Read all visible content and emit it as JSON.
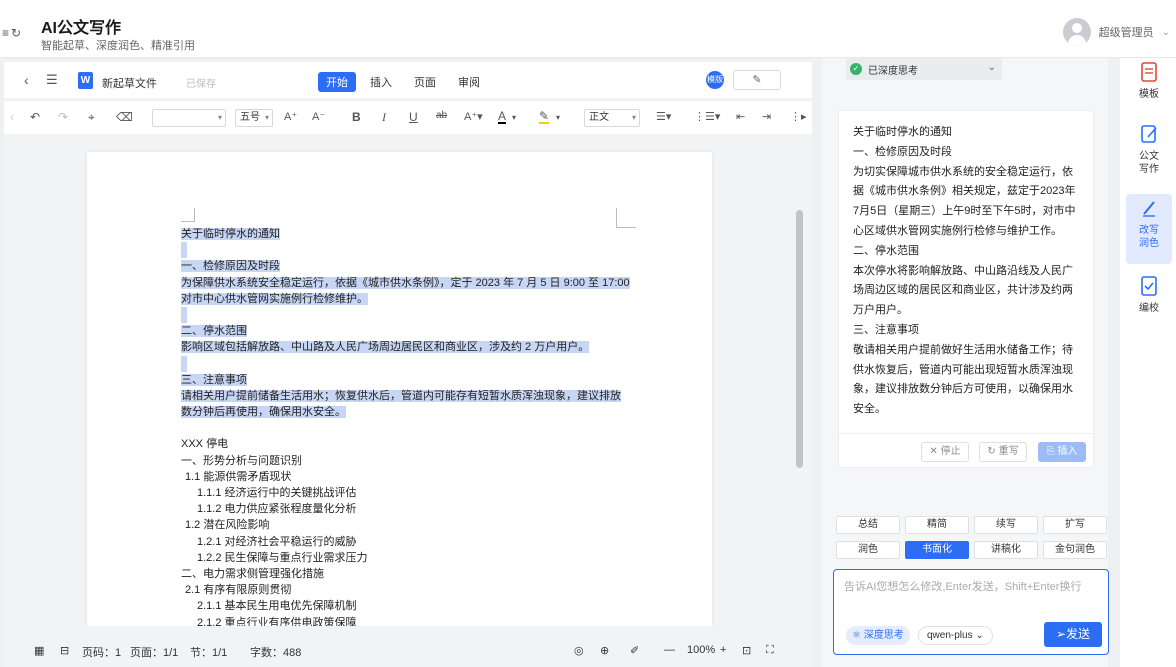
{
  "header": {
    "title": "AI公文写作",
    "subtitle": "智能起草、深度润色、精准引用",
    "user_name": "超级管理员"
  },
  "doc_bar": {
    "file_name": "新起草文件",
    "save_status": "已保存",
    "tabs": [
      {
        "label": "开始",
        "active": true
      },
      {
        "label": "插入",
        "active": false
      },
      {
        "label": "页面",
        "active": false
      },
      {
        "label": "审阅",
        "active": false
      }
    ],
    "share_label": "模版"
  },
  "toolbar": {
    "font_name": "",
    "font_size": "五号",
    "paragraph_style": "正文"
  },
  "document": {
    "lines": [
      {
        "text": "关于临时停水的通知",
        "selected": true,
        "indent": 0
      },
      {
        "text": "",
        "selected": true,
        "indent": 0
      },
      {
        "text": "一、检修原因及时段",
        "selected": true,
        "indent": 0
      },
      {
        "text": "为保障供水系统安全稳定运行，依据《城市供水条例》，定于 2023 年 7 月 5 日 9:00 至 17:00",
        "selected": true,
        "indent": 0
      },
      {
        "text": "对市中心供水管网实施例行检修维护。",
        "selected": true,
        "indent": 0
      },
      {
        "text": "",
        "selected": true,
        "indent": 0
      },
      {
        "text": "二、停水范围",
        "selected": true,
        "indent": 0
      },
      {
        "text": "影响区域包括解放路、中山路及人民广场周边居民区和商业区，涉及约 2 万户用户。",
        "selected": true,
        "indent": 0
      },
      {
        "text": "",
        "selected": true,
        "indent": 0
      },
      {
        "text": "三、注意事项",
        "selected": true,
        "indent": 0
      },
      {
        "text": "请相关用户提前储备生活用水；恢复供水后，管道内可能存有短暂水质浑浊现象，建议排放",
        "selected": true,
        "indent": 0
      },
      {
        "text": "数分钟后再使用，确保用水安全。",
        "selected": true,
        "indent": 0
      },
      {
        "text": "",
        "selected": false,
        "indent": 0
      },
      {
        "text": "XXX 停电",
        "selected": false,
        "indent": 0
      },
      {
        "text": "一、形势分析与问题识别",
        "selected": false,
        "indent": 0
      },
      {
        "text": "1.1  能源供需矛盾现状",
        "selected": false,
        "indent": 1
      },
      {
        "text": "1.1.1  经济运行中的关键挑战评估",
        "selected": false,
        "indent": 2
      },
      {
        "text": "1.1.2  电力供应紧张程度量化分析",
        "selected": false,
        "indent": 2
      },
      {
        "text": "1.2  潜在风险影响",
        "selected": false,
        "indent": 1
      },
      {
        "text": "1.2.1  对经济社会平稳运行的威胁",
        "selected": false,
        "indent": 2
      },
      {
        "text": "1.2.2  民生保障与重点行业需求压力",
        "selected": false,
        "indent": 2
      },
      {
        "text": "二、电力需求侧管理强化措施",
        "selected": false,
        "indent": 0
      },
      {
        "text": "2.1  有序有限原则贯彻",
        "selected": false,
        "indent": 1
      },
      {
        "text": "2.1.1  基本民生用电优先保障机制",
        "selected": false,
        "indent": 2
      },
      {
        "text": "2.1.2  重点行业有序供电政策保障",
        "selected": false,
        "indent": 2
      }
    ]
  },
  "status_bar": {
    "page_label": "页码：1",
    "pages_label": "页面：1/1",
    "section_label": "节：1/1",
    "word_count": "字数：488",
    "zoom": "100%"
  },
  "ai_panel": {
    "deep_thought_label": "已深度思考",
    "result_lines": [
      "关于临时停水的通知",
      "一、检修原因及时段",
      "为切实保障城市供水系统的安全稳定运行，依",
      "据《城市供水条例》相关规定，兹定于2023年",
      "7月5日（星期三）上午9时至下午5时，对市中",
      "心区域供水管网实施例行检修与维护工作。",
      "二、停水范围",
      "本次停水将影响解放路、中山路沿线及人民广",
      "场周边区域的居民区和商业区，共计涉及约两",
      "万户用户。",
      "三、注意事项",
      "敬请相关用户提前做好生活用水储备工作；待",
      "供水恢复后，管道内可能出现短暂水质浑浊现",
      "象，建议排放数分钟后方可使用，以确保用水",
      "安全。"
    ],
    "actions": {
      "stop": "停止",
      "rewrite": "重写",
      "insert": "插入"
    },
    "quick_actions": [
      {
        "label": "总结",
        "active": false
      },
      {
        "label": "精简",
        "active": false
      },
      {
        "label": "续写",
        "active": false
      },
      {
        "label": "扩写",
        "active": false
      },
      {
        "label": "润色",
        "active": false
      },
      {
        "label": "书面化",
        "active": true
      },
      {
        "label": "讲稿化",
        "active": false
      },
      {
        "label": "金句润色",
        "active": false
      }
    ],
    "input_placeholder": "告诉AI您想怎么修改,Enter发送，Shift+Enter换行",
    "deep_chip": "深度思考",
    "model": "qwen-plus",
    "send_label": "发送"
  },
  "right_sidebar": {
    "items": [
      {
        "label": "模板",
        "active": false
      },
      {
        "label": "公文\n写作",
        "active": false
      },
      {
        "label": "改写\n润色",
        "active": true
      },
      {
        "label": "编校",
        "active": false
      }
    ]
  },
  "colors": {
    "accent": "#2b6ef5",
    "selection": "#c7d6f5",
    "success": "#36b36b"
  }
}
